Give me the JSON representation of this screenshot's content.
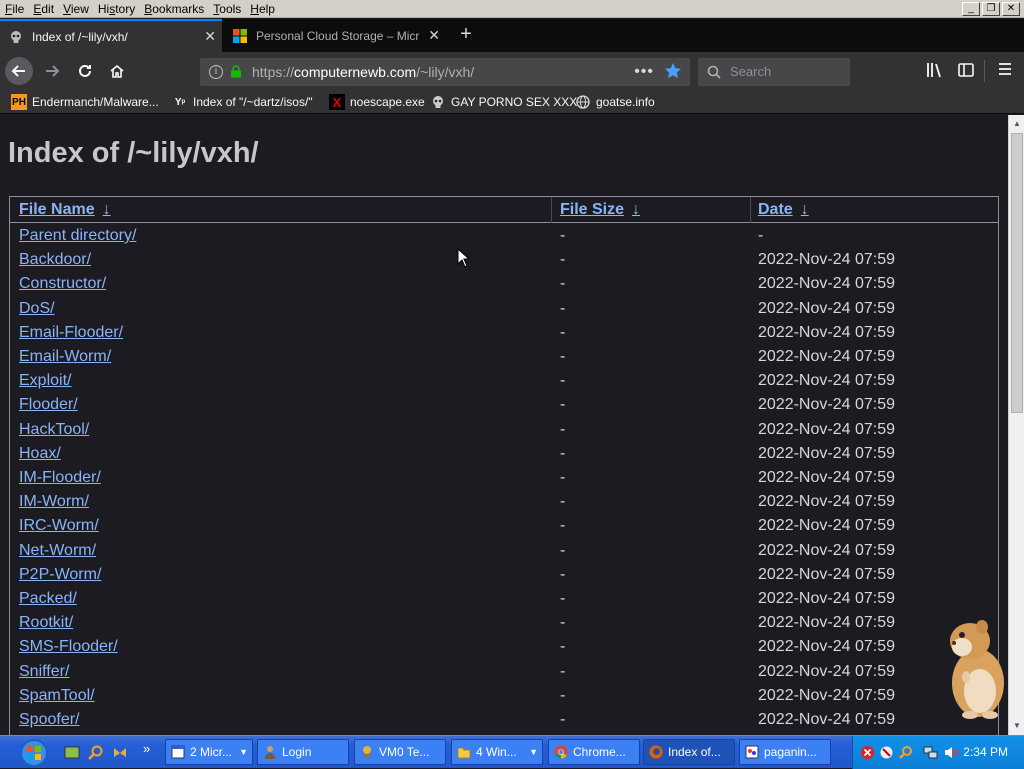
{
  "menubar": {
    "items": [
      "File",
      "Edit",
      "View",
      "History",
      "Bookmarks",
      "Tools",
      "Help"
    ],
    "accel": [
      "F",
      "E",
      "V",
      "s",
      "B",
      "T",
      "H"
    ]
  },
  "tabs": [
    {
      "title": "Index of /~lily/vxh/",
      "active": true
    },
    {
      "title": "Personal Cloud Storage – Micr",
      "active": false
    }
  ],
  "urlbar": {
    "scheme": "https://",
    "host": "computernewb.com",
    "path": "/~lily/vxh/",
    "more": "•••"
  },
  "search": {
    "placeholder": "Search"
  },
  "bookmarks": [
    {
      "label": "Endermanch/Malware...",
      "icon": "ph-icon"
    },
    {
      "label": "Index of \"/~dartz/isos/\"",
      "icon": "y-icon"
    },
    {
      "label": "noescape.exe",
      "icon": "x-icon"
    },
    {
      "label": "GAY PORNO SEX XXX",
      "icon": "skull-icon"
    },
    {
      "label": "goatse.info",
      "icon": "globe-icon"
    }
  ],
  "page": {
    "title": "Index of /~lily/vxh/",
    "columns": {
      "name": "File Name",
      "size": "File Size",
      "date": "Date",
      "arrow": "↓"
    },
    "rows": [
      {
        "name": "Parent directory/",
        "size": "-",
        "date": "-"
      },
      {
        "name": "Backdoor/",
        "size": "-",
        "date": "2022-Nov-24 07:59"
      },
      {
        "name": "Constructor/",
        "size": "-",
        "date": "2022-Nov-24 07:59"
      },
      {
        "name": "DoS/",
        "size": "-",
        "date": "2022-Nov-24 07:59"
      },
      {
        "name": "Email-Flooder/",
        "size": "-",
        "date": "2022-Nov-24 07:59"
      },
      {
        "name": "Email-Worm/",
        "size": "-",
        "date": "2022-Nov-24 07:59"
      },
      {
        "name": "Exploit/",
        "size": "-",
        "date": "2022-Nov-24 07:59"
      },
      {
        "name": "Flooder/",
        "size": "-",
        "date": "2022-Nov-24 07:59"
      },
      {
        "name": "HackTool/",
        "size": "-",
        "date": "2022-Nov-24 07:59"
      },
      {
        "name": "Hoax/",
        "size": "-",
        "date": "2022-Nov-24 07:59"
      },
      {
        "name": "IM-Flooder/",
        "size": "-",
        "date": "2022-Nov-24 07:59"
      },
      {
        "name": "IM-Worm/",
        "size": "-",
        "date": "2022-Nov-24 07:59"
      },
      {
        "name": "IRC-Worm/",
        "size": "-",
        "date": "2022-Nov-24 07:59"
      },
      {
        "name": "Net-Worm/",
        "size": "-",
        "date": "2022-Nov-24 07:59"
      },
      {
        "name": "P2P-Worm/",
        "size": "-",
        "date": "2022-Nov-24 07:59"
      },
      {
        "name": "Packed/",
        "size": "-",
        "date": "2022-Nov-24 07:59"
      },
      {
        "name": "Rootkit/",
        "size": "-",
        "date": "2022-Nov-24 07:59"
      },
      {
        "name": "SMS-Flooder/",
        "size": "-",
        "date": "2022-Nov-24 07:59"
      },
      {
        "name": "Sniffer/",
        "size": "-",
        "date": "2022-Nov-24 07:59"
      },
      {
        "name": "SpamTool/",
        "size": "-",
        "date": "2022-Nov-24 07:59"
      },
      {
        "name": "Spoofer/",
        "size": "-",
        "date": "2022-Nov-24 07:59"
      }
    ]
  },
  "taskbar": {
    "start_icon": "windows-logo-icon",
    "overflow": "»",
    "buttons": [
      {
        "label": "2 Micr...",
        "icon": "window-icon",
        "dropdown": true
      },
      {
        "label": "Login",
        "icon": "person-icon",
        "dropdown": false
      },
      {
        "label": "VM0 Te...",
        "icon": "vm-icon",
        "dropdown": false
      },
      {
        "label": "4 Win...",
        "icon": "folder-icon",
        "dropdown": true
      },
      {
        "label": "Chrome...",
        "icon": "chrome-icon",
        "dropdown": false
      },
      {
        "label": "Index of...",
        "icon": "firefox-icon",
        "dropdown": false,
        "active": true
      },
      {
        "label": "paganin...",
        "icon": "paint-icon",
        "dropdown": false
      }
    ],
    "clock": "2:34 PM"
  },
  "colors": {
    "accent": "#0a84ff",
    "link": "#8ab4f8",
    "page_bg": "#1c1b22",
    "toolbar_bg": "#323234",
    "taskbar_blue": "#245ed8"
  }
}
